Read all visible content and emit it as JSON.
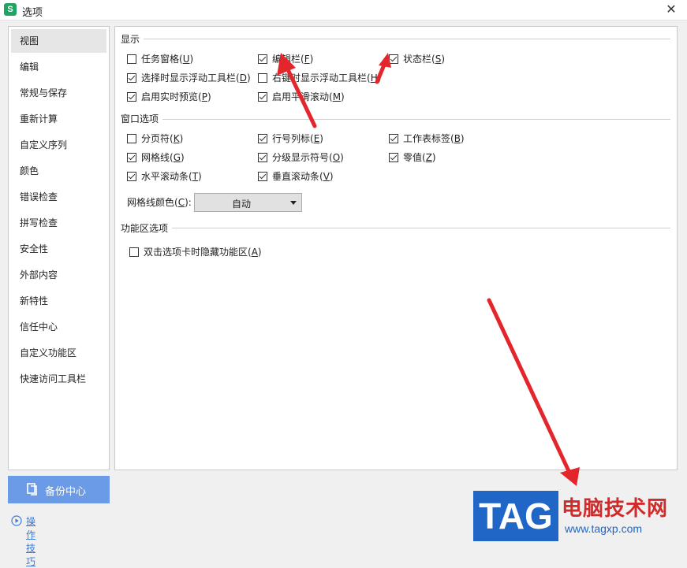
{
  "window": {
    "title": "选项",
    "app_icon_letter": "S",
    "close_glyph": "✕"
  },
  "sidebar": {
    "items": [
      {
        "label": "视图",
        "active": true
      },
      {
        "label": "编辑"
      },
      {
        "label": "常规与保存"
      },
      {
        "label": "重新计算"
      },
      {
        "label": "自定义序列"
      },
      {
        "label": "颜色"
      },
      {
        "label": "错误检查"
      },
      {
        "label": "拼写检查"
      },
      {
        "label": "安全性"
      },
      {
        "label": "外部内容"
      },
      {
        "label": "新特性"
      },
      {
        "label": "信任中心"
      },
      {
        "label": "自定义功能区"
      },
      {
        "label": "快速访问工具栏"
      }
    ]
  },
  "display": {
    "title": "显示",
    "options": [
      {
        "text": "任务窗格(",
        "key": "U",
        "tail": ")",
        "checked": false
      },
      {
        "text": "编辑栏(",
        "key": "F",
        "tail": ")",
        "checked": true
      },
      {
        "text": "状态栏(",
        "key": "S",
        "tail": ")",
        "checked": true
      },
      {
        "text": "选择时显示浮动工具栏(",
        "key": "D",
        "tail": ")",
        "checked": true
      },
      {
        "text": "右键时显示浮动工具栏(",
        "key": "H",
        "tail": ")",
        "checked": false
      },
      {
        "text": "启用实时预览(",
        "key": "P",
        "tail": ")",
        "checked": true
      },
      {
        "text": "启用平滑滚动(",
        "key": "M",
        "tail": ")",
        "checked": true
      }
    ]
  },
  "window_options": {
    "title": "窗口选项",
    "options": [
      {
        "text": "分页符(",
        "key": "K",
        "tail": ")",
        "checked": false
      },
      {
        "text": "行号列标(",
        "key": "E",
        "tail": ")",
        "checked": true
      },
      {
        "text": "工作表标签(",
        "key": "B",
        "tail": ")",
        "checked": true
      },
      {
        "text": "网格线(",
        "key": "G",
        "tail": ")",
        "checked": true
      },
      {
        "text": "分级显示符号(",
        "key": "O",
        "tail": ")",
        "checked": true
      },
      {
        "text": "零值(",
        "key": "Z",
        "tail": ")",
        "checked": true
      },
      {
        "text": "水平滚动条(",
        "key": "T",
        "tail": ")",
        "checked": true
      },
      {
        "text": "垂直滚动条(",
        "key": "V",
        "tail": ")",
        "checked": true
      }
    ],
    "gridline_color": {
      "label": "网格线颜色(",
      "key": "C",
      "tail": "):",
      "value": "自动"
    }
  },
  "ribbon": {
    "title": "功能区选项",
    "options": [
      {
        "text": "双击选项卡时隐藏功能区(",
        "key": "A",
        "tail": ")",
        "checked": false
      }
    ]
  },
  "footer": {
    "backup_label": "备份中心",
    "tips_label": "操作技巧"
  },
  "watermark": {
    "logo": "TAG",
    "site_name": "电脑技术网",
    "url": "www.tagxp.com"
  },
  "colors": {
    "accent": "#6b9be6",
    "annotation_arrow": "#e3262b",
    "link": "#3b7bd6"
  }
}
